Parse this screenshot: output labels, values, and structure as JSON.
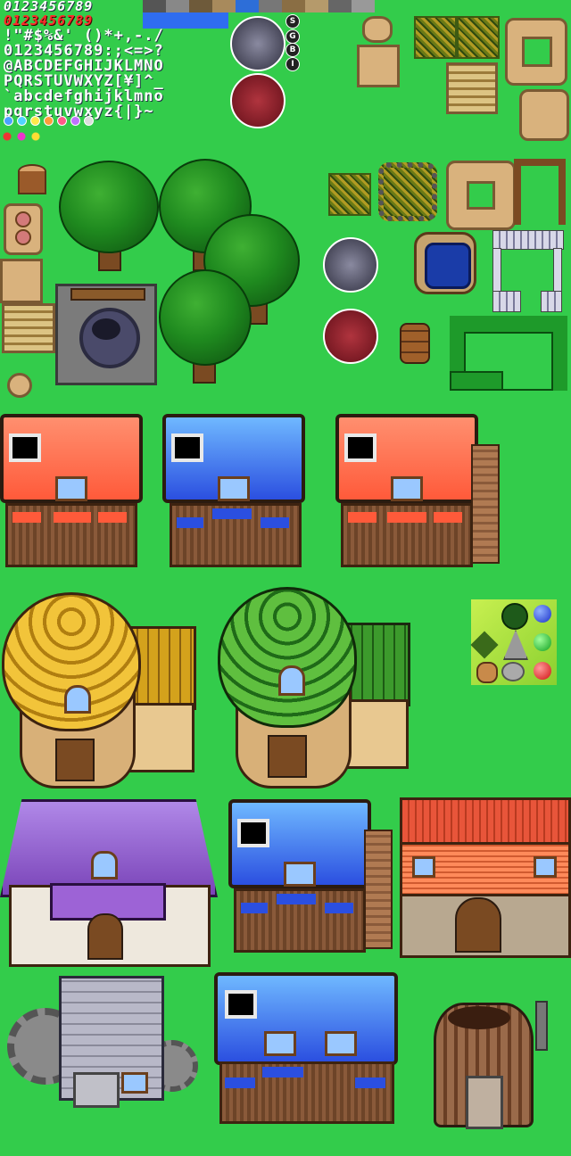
{
  "sheet": {
    "font_rows": {
      "digits_white": "0123456789",
      "digits_red": "0123456789",
      "symbols": "!\"#$%&' ()*+,-./",
      "numbers": "0123456789:;<=>?",
      "upper1": "@ABCDEFGHIJKLMNO",
      "upper2": "PQRSTUVWXYZ[¥]^_",
      "lower1": "`abcdefghijklmno",
      "lower2": "pqrstuvwxyz{|}~"
    },
    "badges": [
      "S",
      "G",
      "B",
      "I"
    ],
    "colors": {
      "grass": "#33cc4b",
      "roof_red": "#ff6f4f",
      "roof_blue": "#3a5ff0",
      "roof_thatch": "#d4a21c",
      "roof_green": "#3c9a2c",
      "roof_purple": "#9d63d6",
      "wood": "#7a4a22"
    },
    "dot_colors": [
      "#49a2ff",
      "#50d4ff",
      "#ffe94a",
      "#ff9d3a",
      "#ff5a8a",
      "#c071ff",
      "#dddddd"
    ],
    "icons": [
      "stump-icon",
      "tree-icon",
      "well-icon",
      "barrel-icon",
      "pond-icon",
      "fence-icon",
      "hedge-icon",
      "bush-icon",
      "blue-orb-icon",
      "leaf-icon",
      "rock-icon",
      "green-orb-icon",
      "red-orb-icon"
    ]
  }
}
